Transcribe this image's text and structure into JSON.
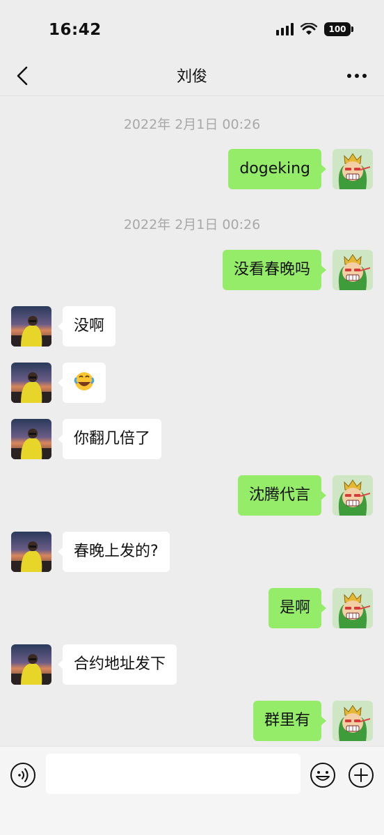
{
  "status_bar": {
    "time": "16:42",
    "battery": "100"
  },
  "header": {
    "title": "刘俊"
  },
  "chat": {
    "timestamps": [
      "2022年 2月1日 00:26",
      "2022年 2月1日 00:26"
    ],
    "messages": [
      {
        "side": "out",
        "text": "dogeking"
      },
      {
        "side": "out",
        "text": "没看春晚吗"
      },
      {
        "side": "in",
        "text": "没啊"
      },
      {
        "side": "in",
        "text": "",
        "emoji": "rolling-laughing-emoji"
      },
      {
        "side": "in",
        "text": "你翻几倍了"
      },
      {
        "side": "out",
        "text": "沈腾代言"
      },
      {
        "side": "in",
        "text": "春晚上发的?"
      },
      {
        "side": "out",
        "text": "是啊"
      },
      {
        "side": "in",
        "text": "合约地址发下"
      },
      {
        "side": "out",
        "text": "群里有"
      }
    ]
  },
  "input_bar": {
    "value": "",
    "icons": [
      "voice-icon",
      "emoji-icon",
      "plus-icon"
    ]
  },
  "colors": {
    "outgoing_bubble": "#95ec69",
    "incoming_bubble": "#ffffff",
    "background": "#ededed"
  }
}
